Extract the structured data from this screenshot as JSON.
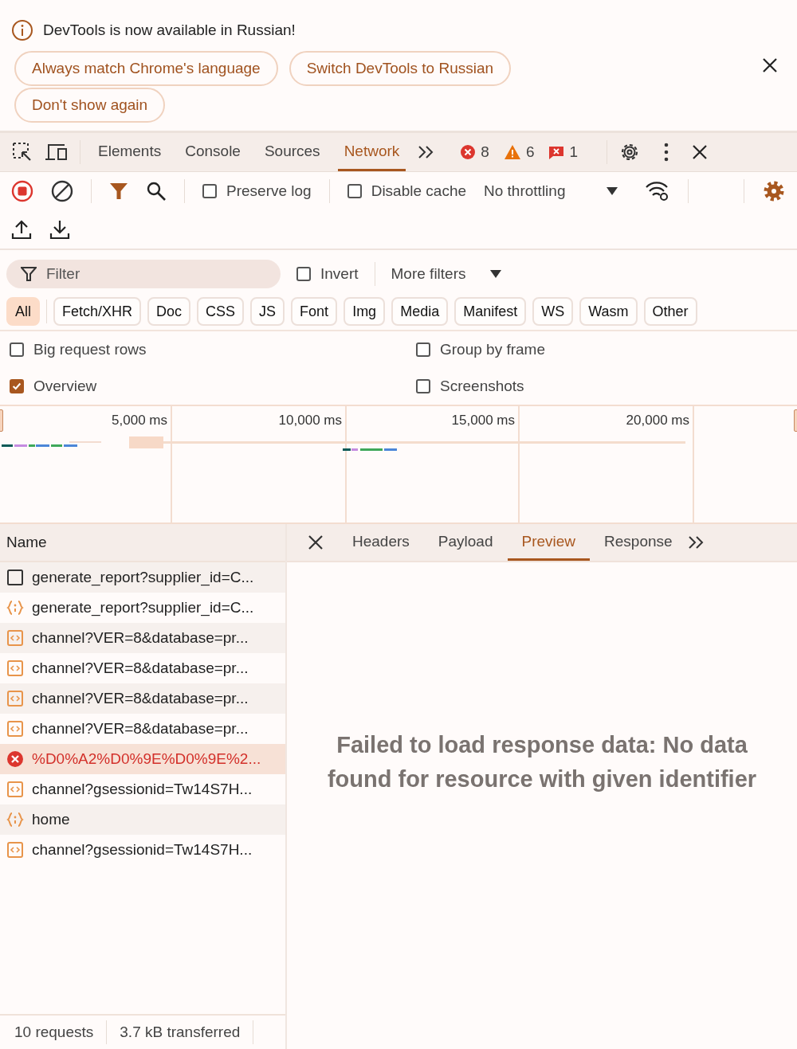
{
  "infobar": {
    "message": "DevTools is now available in Russian!",
    "buttons": [
      "Always match Chrome's language",
      "Switch DevTools to Russian",
      "Don't show again"
    ]
  },
  "main_tabs": [
    {
      "label": "Elements",
      "selected": false
    },
    {
      "label": "Console",
      "selected": false
    },
    {
      "label": "Sources",
      "selected": false
    },
    {
      "label": "Network",
      "selected": true
    }
  ],
  "counts": {
    "errors": "8",
    "warnings": "6",
    "issues": "1"
  },
  "toolbar": {
    "preserve_log": {
      "label": "Preserve log",
      "checked": false
    },
    "disable_cache": {
      "label": "Disable cache",
      "checked": false
    },
    "throttling": "No throttling"
  },
  "filter": {
    "placeholder": "Filter",
    "invert": {
      "label": "Invert",
      "checked": false
    },
    "more_filters": "More filters"
  },
  "type_filters": [
    {
      "label": "All",
      "selected": true
    },
    {
      "label": "Fetch/XHR",
      "selected": false
    },
    {
      "label": "Doc",
      "selected": false
    },
    {
      "label": "CSS",
      "selected": false
    },
    {
      "label": "JS",
      "selected": false
    },
    {
      "label": "Font",
      "selected": false
    },
    {
      "label": "Img",
      "selected": false
    },
    {
      "label": "Media",
      "selected": false
    },
    {
      "label": "Manifest",
      "selected": false
    },
    {
      "label": "WS",
      "selected": false
    },
    {
      "label": "Wasm",
      "selected": false
    },
    {
      "label": "Other",
      "selected": false
    }
  ],
  "options": [
    {
      "label": "Big request rows",
      "checked": false
    },
    {
      "label": "Group by frame",
      "checked": false
    },
    {
      "label": "Overview",
      "checked": true
    },
    {
      "label": "Screenshots",
      "checked": false
    }
  ],
  "overview": {
    "ticks": [
      "5,000 ms",
      "10,000 ms",
      "15,000 ms",
      "20,000 ms"
    ]
  },
  "requests": {
    "column": "Name",
    "rows": [
      {
        "name": "generate_report?supplier_id=C...",
        "kind": "doc",
        "selected": false
      },
      {
        "name": "generate_report?supplier_id=C...",
        "kind": "script",
        "selected": false
      },
      {
        "name": "channel?VER=8&database=pr...",
        "kind": "xhr",
        "selected": false
      },
      {
        "name": "channel?VER=8&database=pr...",
        "kind": "xhr",
        "selected": false
      },
      {
        "name": "channel?VER=8&database=pr...",
        "kind": "xhr",
        "selected": false
      },
      {
        "name": "channel?VER=8&database=pr...",
        "kind": "xhr",
        "selected": false
      },
      {
        "name": "%D0%A2%D0%9E%D0%9E%2...",
        "kind": "error",
        "selected": true
      },
      {
        "name": "channel?gsessionid=Tw14S7H...",
        "kind": "xhr",
        "selected": false
      },
      {
        "name": "home",
        "kind": "script",
        "selected": false
      },
      {
        "name": "channel?gsessionid=Tw14S7H...",
        "kind": "xhr",
        "selected": false
      }
    ]
  },
  "detail": {
    "tabs": [
      {
        "label": "Headers",
        "selected": false
      },
      {
        "label": "Payload",
        "selected": false
      },
      {
        "label": "Preview",
        "selected": true
      },
      {
        "label": "Response",
        "selected": false
      }
    ],
    "message": "Failed to load response data: No data found for resource with given identifier"
  },
  "status_bar": [
    "10 requests",
    "3.7 kB transferred"
  ]
}
